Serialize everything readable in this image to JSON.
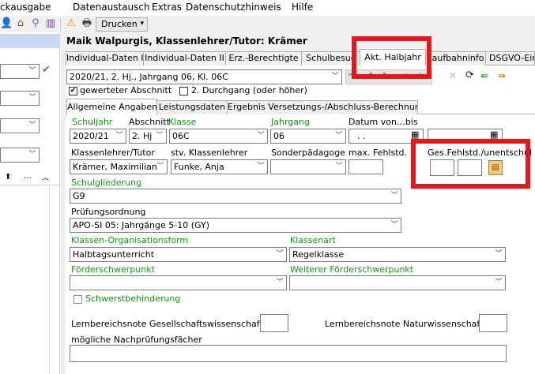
{
  "menu": {
    "items": [
      "ckausgabe",
      "Datenaustausch",
      "Extras",
      "Datenschutzhinweis",
      "Hilfe"
    ]
  },
  "toolbar": {
    "print_label": "Drucken",
    "dropdown_glyph": "▾"
  },
  "student": {
    "header": "Maik Walpurgis, Klassenlehrer/Tutor: Krämer"
  },
  "tabs_top": [
    "Individual-Daten I",
    "Individual-Daten II",
    "Erz.-Berechtigte",
    "Schulbesuc",
    "Akt. Halbjahr",
    "Laufbahninfo",
    "DSGVO-Ein"
  ],
  "period_select": "2020/21, 2. Hj., Jahrgang 06, Kl. 06C",
  "checkboxes": {
    "gewerteter": "gewerteter Abschnitt",
    "durchgang": "2. Durchgang (oder höher)",
    "schwerstbehinderung": "Schwerstbehinderung"
  },
  "subtabs": [
    "Allgemeine Angaben",
    "Leistungsdaten",
    "Ergebnis Versetzungs-/Abschluss-Berechnung"
  ],
  "form": {
    "schuljahr_label": "Schuljahr",
    "schuljahr_value": "2020/21",
    "abschnitt_label": "Abschnitt",
    "abschnitt_value": "2. Hj",
    "klasse_label": "Klasse",
    "klasse_value": "06C",
    "jahrgang_label": "Jahrgang",
    "jahrgang_value": "06",
    "datum_label": "Datum von…bis",
    "datum_value": ". .",
    "klassenlehrer_label": "Klassenlehrer/Tutor",
    "klassenlehrer_value": "Krämer, Maximilian",
    "stv_label": "stv. Klassenlehrer",
    "stv_value": "Funke, Anja",
    "sonderpaed_label": "Sonderpädagoge",
    "fehlstd_label": "max. Fehlstd.",
    "gesfehl_label": "Ges.Fehlstd./unentschul",
    "schulgliederung_label": "Schulgliederung",
    "schulgliederung_value": "G9",
    "pruefungsordnung_label": "Prüfungsordnung",
    "pruefungsordnung_value": "APO-SI 05: Jahrgänge 5-10 (GY)",
    "orgform_label": "Klassen-Organisationsform",
    "orgform_value": "Halbtagsunterricht",
    "klassenart_label": "Klassenart",
    "klassenart_value": "Regelklasse",
    "foerder_label": "Förderschwerpunkt",
    "weiterer_foerder_label": "Weiterer Förderschwerpunkt",
    "lb_gesell_label": "Lernbereichsnote Gesellschaftswissenschaft",
    "lb_natur_label": "Lernbereichsnote Naturwissenschaft",
    "nachpruefung_label": "mögliche Nachprüfungsfächer"
  },
  "colors": {
    "highlight": "#e8161b",
    "green_label": "#109a10"
  }
}
